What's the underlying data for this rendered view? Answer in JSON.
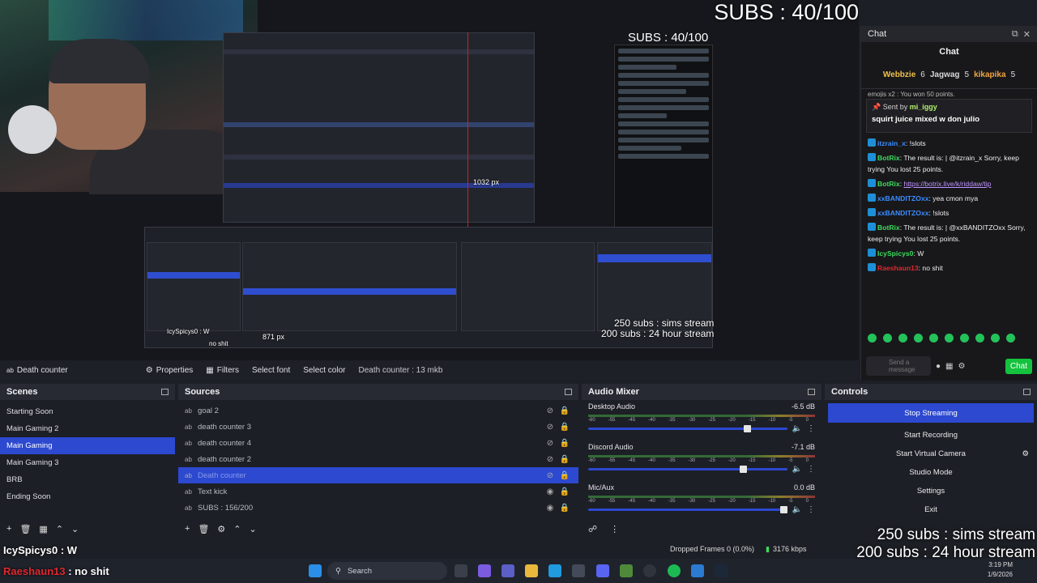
{
  "overlay": {
    "subs_big": "SUBS : 40/100",
    "preview_subs": "SUBS : 40/100",
    "preview_sims": "250 subs : sims stream",
    "preview_24h": "200 subs : 24 hour stream",
    "preview_px_1032": "1032 px",
    "preview_px_871": "871 px",
    "preview_user": "IcySpicys0 : W",
    "preview_user2": "no shit",
    "bottom_user": "IcySpicys0 : W",
    "bottom_user2_name": "Raeshaun13",
    "bottom_user2_msg": " : no shit",
    "sims_stream": "250 subs : sims stream",
    "hour_stream": "200 subs : 24 hour stream"
  },
  "chat": {
    "window_title": "Chat",
    "header": "Chat",
    "leaderboard": {
      "first": "Webbzie",
      "first_count": "6",
      "second": "Jagwag",
      "second_count": "5",
      "third": "kikapika",
      "third_count": "5"
    },
    "scrolled_text": "emojis  x2 : You won 50 points.",
    "pinned": {
      "sent_by_label": "Sent by",
      "sent_by_user": "mi_iggy",
      "message": "squirt juice mixed w don julio"
    },
    "messages": [
      {
        "user": "itzrain_x",
        "color": "#3b8cff",
        "text": ": !slots"
      },
      {
        "user": "BotRix",
        "color": "#3ddc5c",
        "text": ": The result is:   |  @itzrain_x Sorry, keep trying  You lost 25 points."
      },
      {
        "user": "BotRix",
        "color": "#3ddc5c",
        "text": ": ",
        "link": "https://botrix.live/k/riddaw/tip"
      },
      {
        "user": "xxBANDITZOxx",
        "color": "#3b8cff",
        "text": ": yea cmon mya"
      },
      {
        "user": "xxBANDITZOxx",
        "color": "#3b8cff",
        "text": ": !slots"
      },
      {
        "user": "BotRix",
        "color": "#3ddc5c",
        "text": ": The result is:   |  @xxBANDITZOxx Sorry, keep trying  You lost 25 points."
      },
      {
        "user": "IcySpicys0",
        "color": "#3ddc5c",
        "text": ": W"
      },
      {
        "user": "Raeshaun13",
        "color": "#e0282e",
        "text": ": no shit"
      }
    ],
    "input_placeholder": "Send a message",
    "send_label": "Chat"
  },
  "source_toolbar": {
    "source_name": "Death counter",
    "properties": "Properties",
    "filters": "Filters",
    "select_font": "Select font",
    "select_color": "Select color",
    "text_preview": "Death counter : 13 mkb"
  },
  "scenes": {
    "title": "Scenes",
    "items": [
      "Starting Soon",
      "Main Gaming 2",
      "Main Gaming",
      "Main Gaming 3",
      "BRB",
      "Ending Soon"
    ],
    "selected_index": 2
  },
  "sources": {
    "title": "Sources",
    "items": [
      {
        "name": "goal 2",
        "hidden": true
      },
      {
        "name": "death counter 3",
        "hidden": true
      },
      {
        "name": "death counter 4",
        "hidden": true
      },
      {
        "name": "death counter 2",
        "hidden": true
      },
      {
        "name": "Death counter",
        "hidden": true,
        "selected": true
      },
      {
        "name": "Text kick",
        "hidden": false
      },
      {
        "name": "SUBS : 156/200",
        "hidden": false
      }
    ]
  },
  "mixer": {
    "title": "Audio Mixer",
    "scale": [
      "-60",
      "-55",
      "-45",
      "-40",
      "-35",
      "-30",
      "-25",
      "-20",
      "-15",
      "-10",
      "-5",
      "0"
    ],
    "channels": [
      {
        "name": "Desktop Audio",
        "db": "-6.5 dB",
        "level": 0.82
      },
      {
        "name": "Discord Audio",
        "db": "-7.1 dB",
        "level": 0.8
      },
      {
        "name": "Mic/Aux",
        "db": "0.0 dB",
        "level": 1.0
      }
    ]
  },
  "controls": {
    "title": "Controls",
    "stop_streaming": "Stop Streaming",
    "start_recording": "Start Recording",
    "start_virtual_camera": "Start Virtual Camera",
    "studio_mode": "Studio Mode",
    "settings": "Settings",
    "exit": "Exit"
  },
  "status": {
    "dropped_frames": "Dropped Frames 0 (0.0%)",
    "bitrate": "3176 kbps"
  },
  "taskbar": {
    "search": "Search",
    "time": "3:19 PM",
    "date": "1/9/2026"
  },
  "colors": {
    "accent": "#2c49d0",
    "chat_button": "#15c23e"
  }
}
